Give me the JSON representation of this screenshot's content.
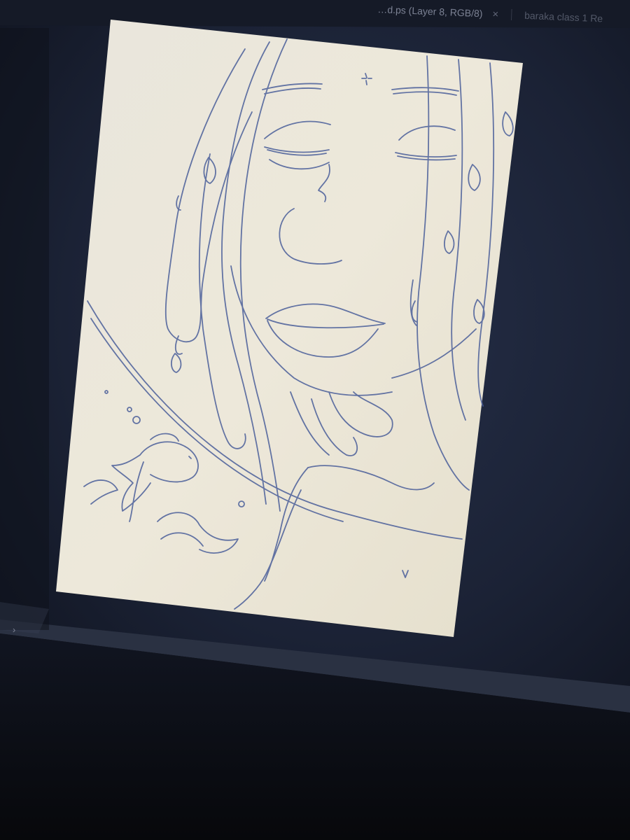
{
  "app": {
    "tabs": [
      {
        "label": "…d.ps (Layer 8, RGB/8)",
        "active": true,
        "close_glyph": "×"
      },
      {
        "label": "baraka class 1 Re",
        "active": false
      }
    ],
    "panel_toggle_glyph": "›"
  },
  "canvas": {
    "artwork": "line sketch portrait",
    "paper_color": "#ece7d8",
    "ink_color": "#4b5f9a",
    "workspace_color": "#1a2030"
  },
  "icons": {
    "tab_close": "close-icon",
    "panel_toggle": "chevron-right-icon"
  }
}
